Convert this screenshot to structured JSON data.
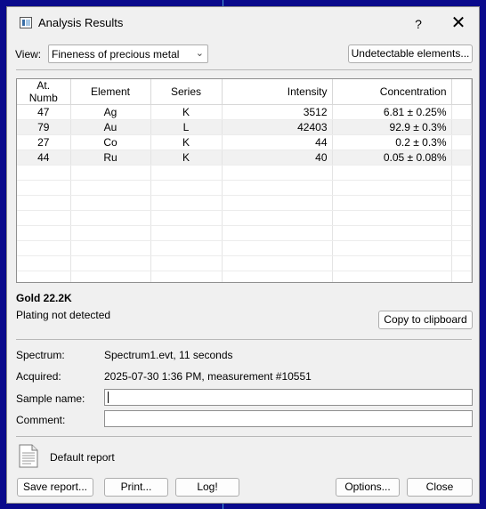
{
  "window": {
    "title": "Analysis Results",
    "help_label": "?",
    "close_label": "✕"
  },
  "toolbar": {
    "view_label": "View:",
    "view_value": "Fineness of precious metal",
    "undetectable_button": "Undetectable elements..."
  },
  "table": {
    "headers": [
      "At. Numb",
      "Element",
      "Series",
      "Intensity",
      "Concentration"
    ],
    "rows": [
      {
        "at_numb": "47",
        "element": "Ag",
        "series": "K",
        "intensity": "3512",
        "concentration": "6.81 ± 0.25%"
      },
      {
        "at_numb": "79",
        "element": "Au",
        "series": "L",
        "intensity": "42403",
        "concentration": "92.9 ± 0.3%"
      },
      {
        "at_numb": "27",
        "element": "Co",
        "series": "K",
        "intensity": "44",
        "concentration": "0.2 ± 0.3%"
      },
      {
        "at_numb": "44",
        "element": "Ru",
        "series": "K",
        "intensity": "40",
        "concentration": "0.05 ± 0.08%"
      }
    ]
  },
  "result": {
    "title": "Gold 22.2K",
    "plating": "Plating not detected",
    "copy_button": "Copy to clipboard"
  },
  "info": {
    "spectrum_label": "Spectrum:",
    "spectrum_value": "Spectrum1.evt,  11 seconds",
    "acquired_label": "Acquired:",
    "acquired_value": "2025-07-30  1:36 PM,  measurement #10551",
    "sample_label": "Sample name:",
    "sample_value": "",
    "comment_label": "Comment:",
    "comment_value": ""
  },
  "report": {
    "name": "Default report",
    "icon": "document-icon"
  },
  "buttons": {
    "save_report": "Save report...",
    "print": "Print...",
    "log": "Log!",
    "options": "Options...",
    "close": "Close"
  }
}
